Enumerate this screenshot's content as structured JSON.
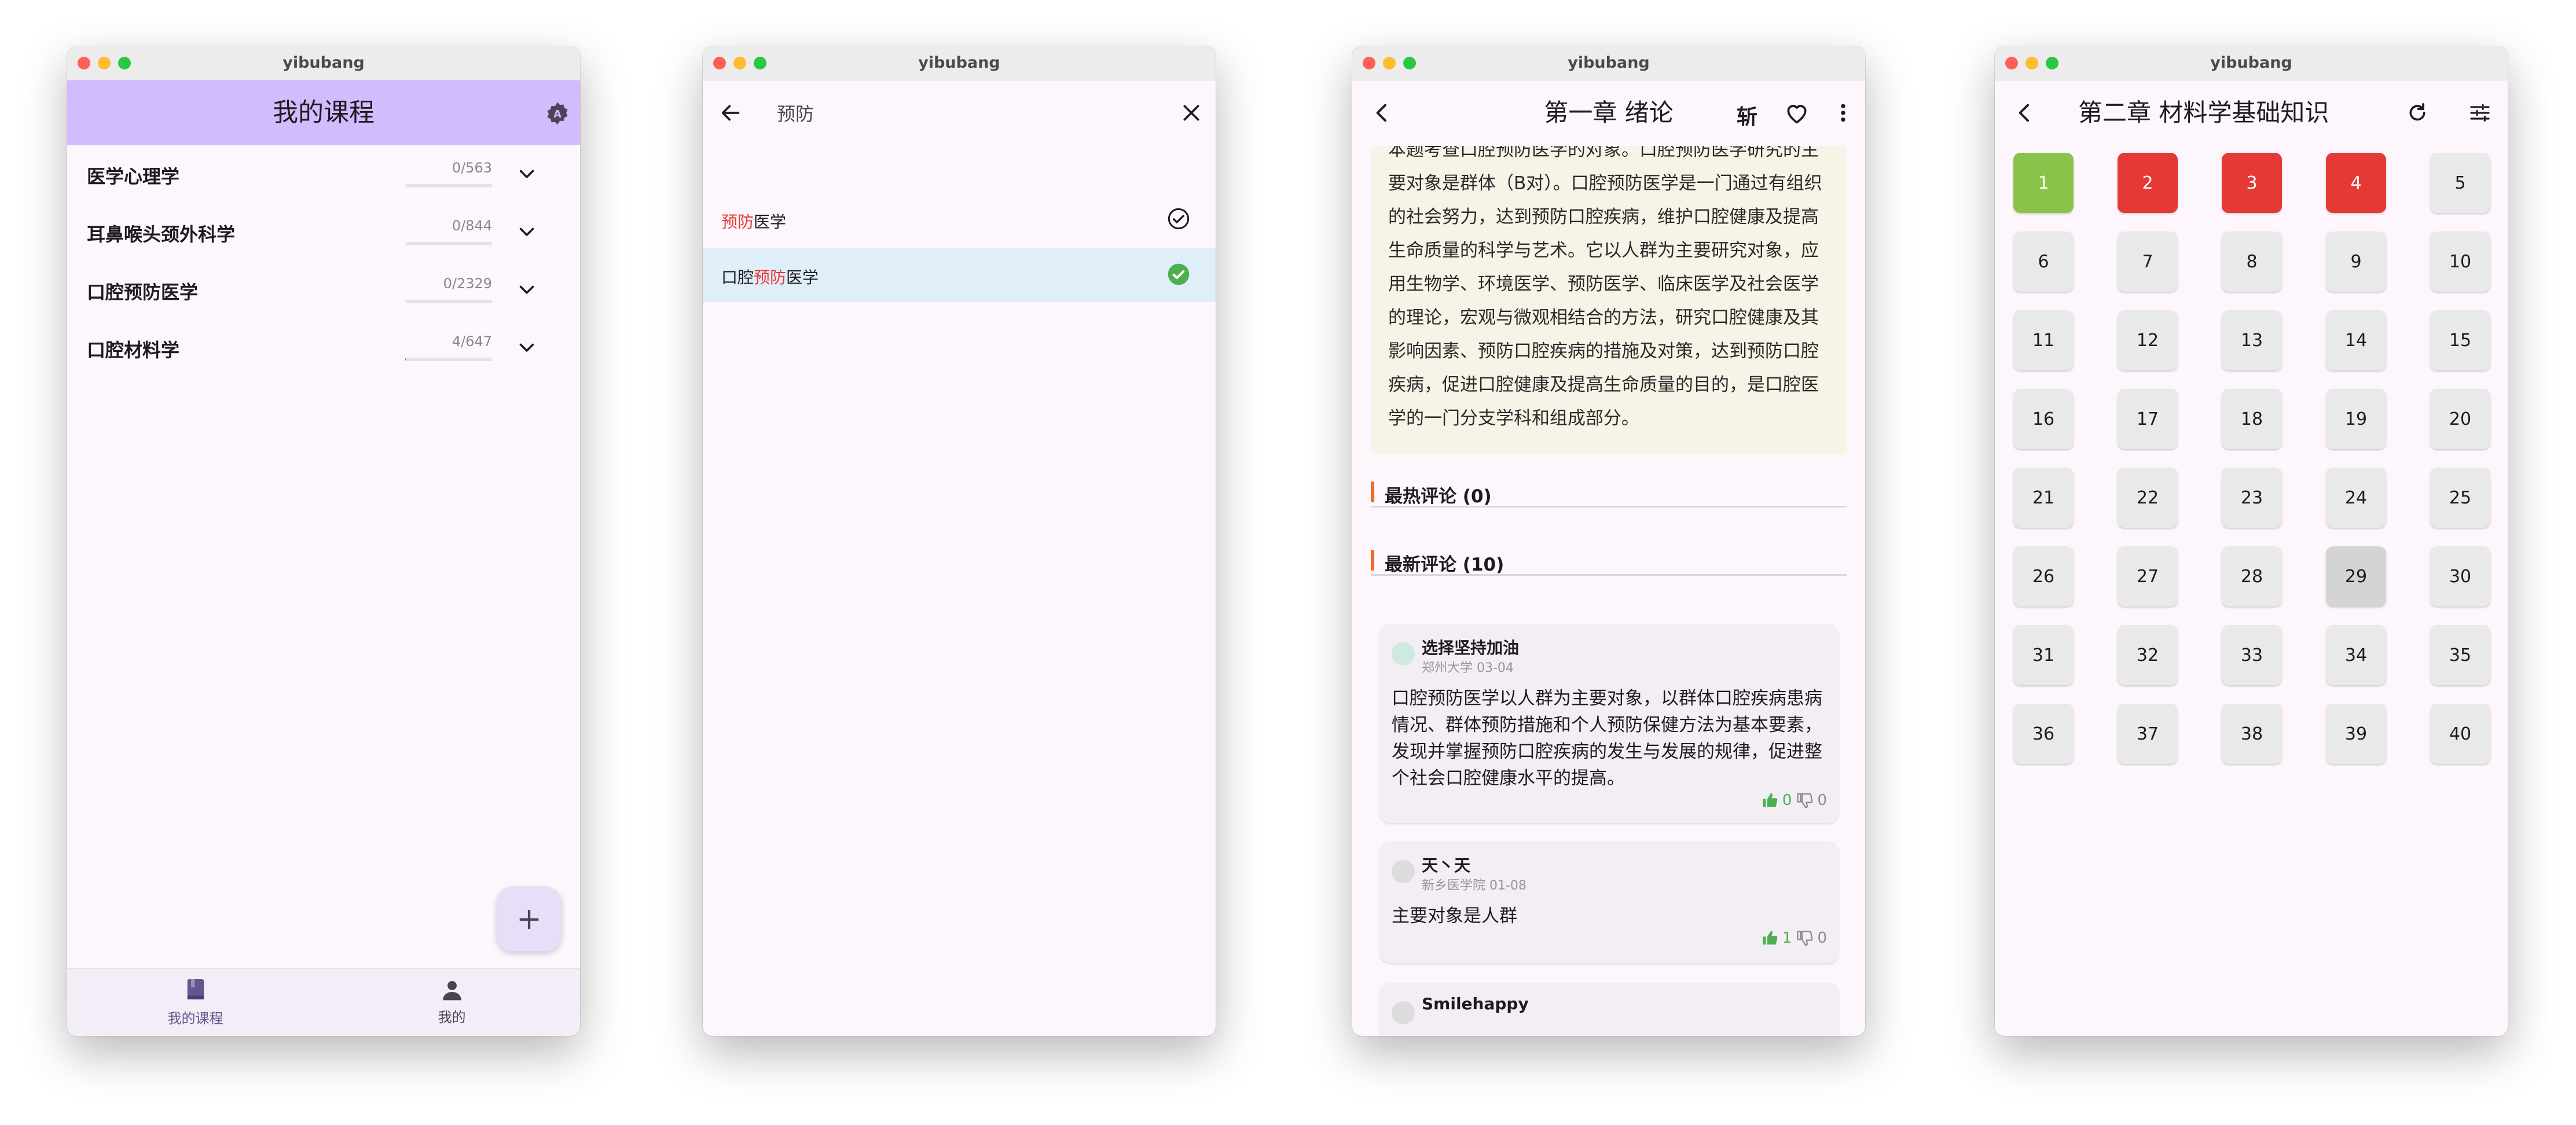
{
  "windows": {
    "w1": {
      "window_title": "yibubang",
      "appbar_title": "我的课程",
      "courses": [
        {
          "name": "医学心理学",
          "progress": "0/563",
          "fraction": 0.0
        },
        {
          "name": "耳鼻喉头颈外科学",
          "progress": "0/844",
          "fraction": 0.0
        },
        {
          "name": "口腔预防医学",
          "progress": "0/2329",
          "fraction": 0.0
        },
        {
          "name": "口腔材料学",
          "progress": "4/647",
          "fraction": 0.006
        }
      ],
      "fab_label": "+",
      "nav": [
        {
          "label": "我的课程",
          "icon": "book-icon",
          "active": true
        },
        {
          "label": "我的",
          "icon": "person-icon",
          "active": false
        }
      ]
    },
    "w2": {
      "window_title": "yibubang",
      "search_value": "预防",
      "results": [
        {
          "before": "",
          "match": "预防",
          "after": "医学",
          "selected": false
        },
        {
          "before": "口腔",
          "match": "预防",
          "after": "医学",
          "selected": true
        }
      ]
    },
    "w3": {
      "window_title": "yibubang",
      "appbar_title": "第一章 绪论",
      "font_toggle_label": "斩",
      "explanation": "本题考查口腔预防医学的对象。口腔预防医学研究的主要对象是群体（B对）。口腔预防医学是一门通过有组织的社会努力，达到预防口腔疾病，维护口腔健康及提高生命质量的科学与艺术。它以人群为主要研究对象，应用生物学、环境医学、预防医学、临床医学及社会医学的理论，宏观与微观相结合的方法，研究口腔健康及其影响因素、预防口腔疾病的措施及对策，达到预防口腔疾病，促进口腔健康及提高生命质量的目的，是口腔医学的一门分支学科和组成部分。",
      "hot_comments_header": "最热评论 (0)",
      "latest_comments_header": "最新评论 (10)",
      "comments": [
        {
          "user": "选择坚持加油",
          "meta": "郑州大学 03-04",
          "body": "口腔预防医学以人群为主要对象，以群体口腔疾病患病情况、群体预防措施和个人预防保健方法为基本要素，发现并掌握预防口腔疾病的发生与发展的规律，促进整个社会口腔健康水平的提高。",
          "likes": "0",
          "dislikes": "0"
        },
        {
          "user": "天丶天",
          "meta": "新乡医学院 01-08",
          "body": "主要对象是人群",
          "likes": "1",
          "dislikes": "0"
        },
        {
          "user": "Smilehappy",
          "meta": "",
          "body": "",
          "likes": "",
          "dislikes": ""
        }
      ]
    },
    "w4": {
      "window_title": "yibubang",
      "appbar_title": "第二章 材料学基础知识",
      "questions": [
        {
          "n": "1",
          "state": "correct"
        },
        {
          "n": "2",
          "state": "wrong"
        },
        {
          "n": "3",
          "state": "wrong"
        },
        {
          "n": "4",
          "state": "wrong"
        },
        {
          "n": "5",
          "state": "none"
        },
        {
          "n": "6",
          "state": "none"
        },
        {
          "n": "7",
          "state": "none"
        },
        {
          "n": "8",
          "state": "none"
        },
        {
          "n": "9",
          "state": "none"
        },
        {
          "n": "10",
          "state": "none"
        },
        {
          "n": "11",
          "state": "none"
        },
        {
          "n": "12",
          "state": "none"
        },
        {
          "n": "13",
          "state": "none"
        },
        {
          "n": "14",
          "state": "none"
        },
        {
          "n": "15",
          "state": "none"
        },
        {
          "n": "16",
          "state": "none"
        },
        {
          "n": "17",
          "state": "none"
        },
        {
          "n": "18",
          "state": "none"
        },
        {
          "n": "19",
          "state": "none"
        },
        {
          "n": "20",
          "state": "none"
        },
        {
          "n": "21",
          "state": "none"
        },
        {
          "n": "22",
          "state": "none"
        },
        {
          "n": "23",
          "state": "none"
        },
        {
          "n": "24",
          "state": "none"
        },
        {
          "n": "25",
          "state": "none"
        },
        {
          "n": "26",
          "state": "none"
        },
        {
          "n": "27",
          "state": "none"
        },
        {
          "n": "28",
          "state": "none"
        },
        {
          "n": "29",
          "state": "current"
        },
        {
          "n": "30",
          "state": "none"
        },
        {
          "n": "31",
          "state": "none"
        },
        {
          "n": "32",
          "state": "none"
        },
        {
          "n": "33",
          "state": "none"
        },
        {
          "n": "34",
          "state": "none"
        },
        {
          "n": "35",
          "state": "none"
        },
        {
          "n": "36",
          "state": "none"
        },
        {
          "n": "37",
          "state": "none"
        },
        {
          "n": "38",
          "state": "none"
        },
        {
          "n": "39",
          "state": "none"
        },
        {
          "n": "40",
          "state": "none"
        }
      ]
    }
  },
  "colors": {
    "appbar_purple": "#d1bcfd",
    "background": "#fdf7fd",
    "highlight_red": "#e53935",
    "correct_green": "#8bc34a",
    "wrong_red": "#e53935",
    "check_green": "#4caf50",
    "comment_accent": "#f06a2a",
    "selected_row": "#dfeef8"
  }
}
